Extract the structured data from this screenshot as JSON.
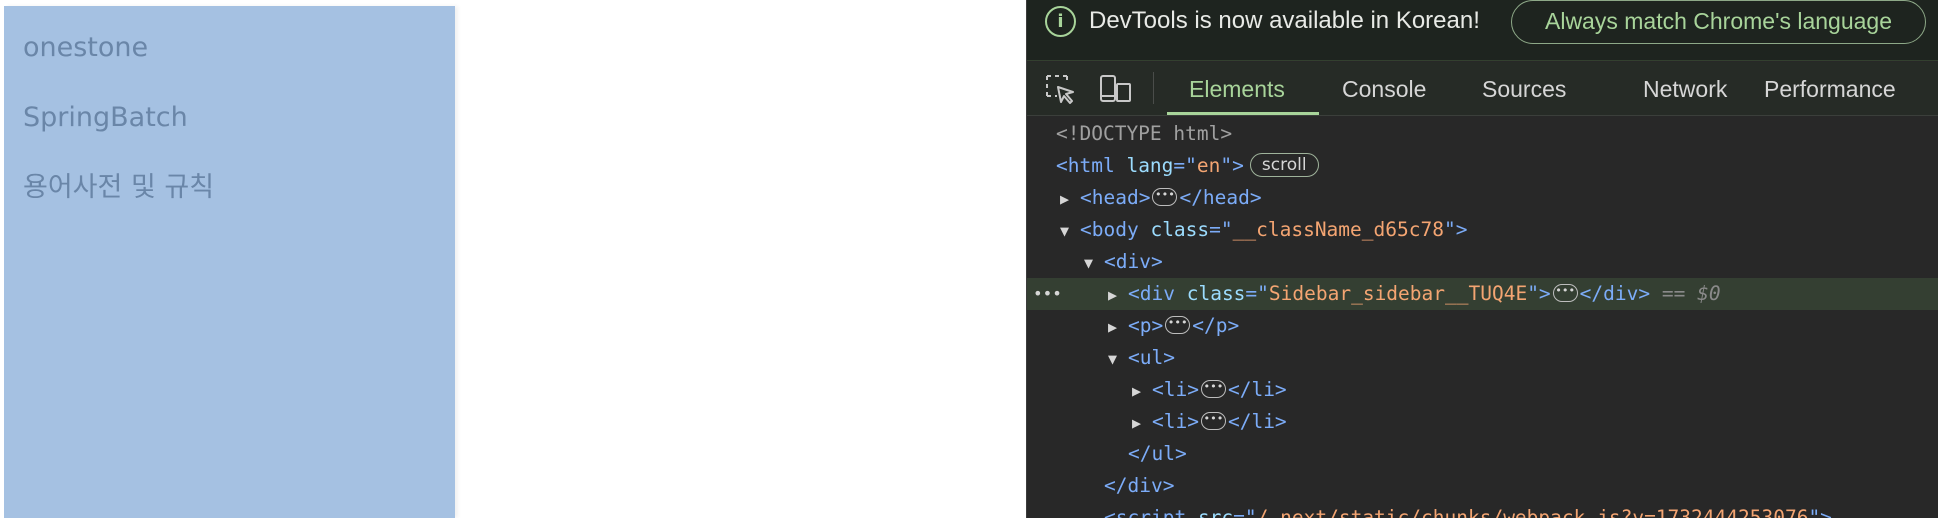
{
  "sidebar": {
    "items": [
      "onestone",
      "SpringBatch",
      "용어사전 및 규칙"
    ]
  },
  "devtools": {
    "infobar": {
      "icon": "info-icon",
      "message": "DevTools is now available in Korean!",
      "button": "Always match Chrome's language"
    },
    "toolbar": {
      "icons": [
        "inspect-element-icon",
        "device-toolbar-icon"
      ],
      "tabs": [
        "Elements",
        "Console",
        "Sources",
        "Network",
        "Performance"
      ],
      "active_tab": "Elements"
    },
    "dom": {
      "doctype": "<!DOCTYPE html>",
      "html_lang": "en",
      "scroll_badge": "scroll",
      "body_class": "__className_d65c78",
      "sidebar_div_class": "Sidebar_sidebar__TUQ4E",
      "selected_marker": "== $0",
      "script_src": "/_next/static/chunks/webpack.js?v=1732444253076"
    },
    "colors": {
      "accent": "#a8d49a",
      "tag": "#7cacf8",
      "attr_value": "#f4a572",
      "background": "#282828"
    }
  }
}
